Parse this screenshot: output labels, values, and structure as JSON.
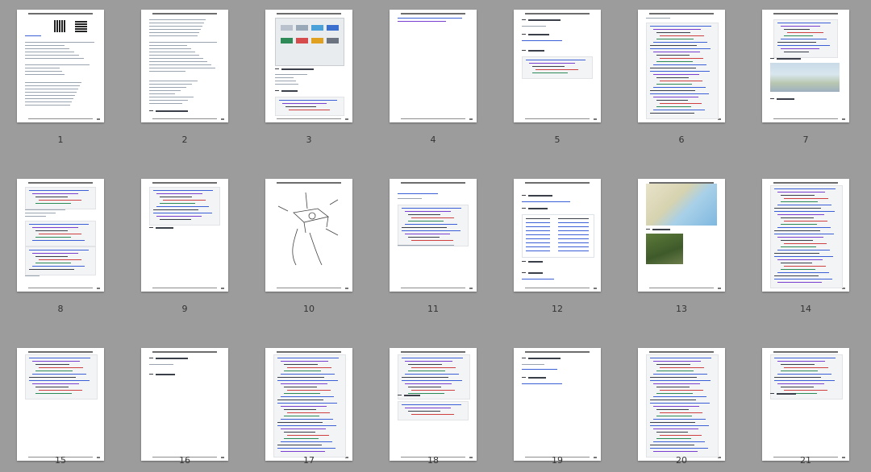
{
  "page_numbers": [
    "1",
    "2",
    "3",
    "4",
    "5",
    "6",
    "7",
    "8",
    "9",
    "10",
    "11",
    "12",
    "13",
    "14",
    "15",
    "16",
    "17",
    "18",
    "19",
    "20",
    "21"
  ],
  "colors": {
    "background": "#9c9c9c",
    "page": "#ffffff",
    "code_blue": "#3b5fd6",
    "code_purple": "#7a3fd0",
    "code_red": "#d04040",
    "code_green": "#2e8b57"
  },
  "page_headings": {
    "p1": "1、教学",
    "p11": "8、播放列表",
    "p12": "9、不同的layer-style"
  }
}
